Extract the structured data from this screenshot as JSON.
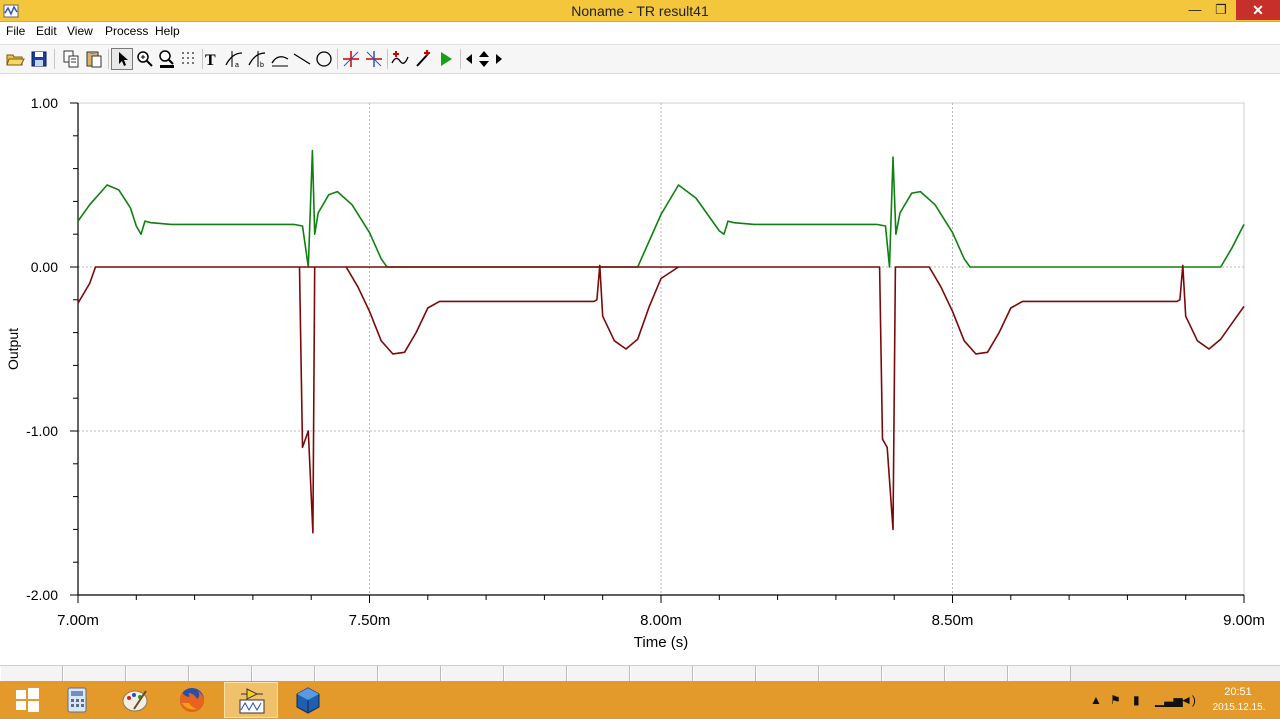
{
  "window": {
    "title": "Noname - TR result41",
    "controls": {
      "minimize": "—",
      "maximize": "❐",
      "close": "✕"
    }
  },
  "menu": [
    "File",
    "Edit",
    "View",
    "Process",
    "Help"
  ],
  "toolbar": {
    "icons": [
      "open-folder-icon",
      "save-icon",
      "copy-icon",
      "paste-icon",
      "pointer-icon",
      "zoom-in-icon",
      "zoom-100-icon",
      "grid-icon",
      "text-icon",
      "cursor-a-icon",
      "cursor-b-icon",
      "line-cursor-icon",
      "line-icon",
      "ellipse-icon",
      "marker-a-icon",
      "marker-b-icon",
      "add-curve-icon",
      "pen-icon",
      "run-icon",
      "left-arrow-icon",
      "up-down-arrow-icon",
      "right-arrow-icon"
    ]
  },
  "chart_data": {
    "type": "line",
    "xlabel": "Time (s)",
    "ylabel": "Output",
    "xlim": [
      0.007,
      0.009
    ],
    "ylim": [
      -2.0,
      1.0
    ],
    "x_ticks": [
      "7.00m",
      "7.50m",
      "8.00m",
      "8.50m",
      "9.00m"
    ],
    "x_tick_values": [
      0.007,
      0.0075,
      0.008,
      0.0085,
      0.009
    ],
    "y_ticks": [
      "1.00",
      "0.00",
      "-1.00",
      "-2.00"
    ],
    "y_tick_values": [
      1.0,
      0.0,
      -1.0,
      -2.0
    ],
    "grid": true,
    "series": [
      {
        "color": "#108010",
        "points": [
          [
            0.007,
            0.28
          ],
          [
            0.00702,
            0.38
          ],
          [
            0.00704,
            0.46
          ],
          [
            0.00705,
            0.5
          ],
          [
            0.00707,
            0.47
          ],
          [
            0.00709,
            0.36
          ],
          [
            0.0071,
            0.25
          ],
          [
            0.007108,
            0.2
          ],
          [
            0.007115,
            0.28
          ],
          [
            0.007125,
            0.27
          ],
          [
            0.00716,
            0.26
          ],
          [
            0.00737,
            0.26
          ],
          [
            0.007385,
            0.25
          ],
          [
            0.007395,
            0.0
          ],
          [
            0.007402,
            0.71
          ],
          [
            0.007406,
            0.2
          ],
          [
            0.007412,
            0.33
          ],
          [
            0.00743,
            0.44
          ],
          [
            0.007445,
            0.46
          ],
          [
            0.00747,
            0.38
          ],
          [
            0.0075,
            0.21
          ],
          [
            0.00752,
            0.05
          ],
          [
            0.00753,
            0.0
          ],
          [
            0.00796,
            0.0
          ],
          [
            0.00798,
            0.16
          ],
          [
            0.008,
            0.32
          ],
          [
            0.00803,
            0.5
          ],
          [
            0.00806,
            0.42
          ],
          [
            0.0081,
            0.22
          ],
          [
            0.008108,
            0.2
          ],
          [
            0.008115,
            0.28
          ],
          [
            0.008125,
            0.27
          ],
          [
            0.00816,
            0.26
          ],
          [
            0.00837,
            0.26
          ],
          [
            0.008385,
            0.25
          ],
          [
            0.008392,
            0.0
          ],
          [
            0.008398,
            0.67
          ],
          [
            0.008403,
            0.2
          ],
          [
            0.00841,
            0.33
          ],
          [
            0.00843,
            0.45
          ],
          [
            0.008445,
            0.46
          ],
          [
            0.00847,
            0.38
          ],
          [
            0.0085,
            0.21
          ],
          [
            0.00852,
            0.05
          ],
          [
            0.00853,
            0.0
          ],
          [
            0.00896,
            0.0
          ],
          [
            0.00898,
            0.12
          ],
          [
            0.009,
            0.26
          ]
        ]
      },
      {
        "color": "#7a0a0a",
        "points": [
          [
            0.007,
            -0.22
          ],
          [
            0.00702,
            -0.1
          ],
          [
            0.00703,
            0.0
          ],
          [
            0.00746,
            0.0
          ],
          [
            0.00748,
            -0.12
          ],
          [
            0.0075,
            -0.27
          ],
          [
            0.00752,
            -0.45
          ],
          [
            0.00754,
            -0.53
          ],
          [
            0.00756,
            -0.52
          ],
          [
            0.00758,
            -0.4
          ],
          [
            0.0076,
            -0.25
          ],
          [
            0.00762,
            -0.21
          ],
          [
            0.007885,
            -0.21
          ],
          [
            0.00789,
            -0.2
          ],
          [
            0.007895,
            0.01
          ],
          [
            0.0079,
            -0.3
          ],
          [
            0.00792,
            -0.45
          ],
          [
            0.00794,
            -0.5
          ],
          [
            0.00796,
            -0.44
          ],
          [
            0.00798,
            -0.24
          ],
          [
            0.008,
            -0.07
          ],
          [
            0.00803,
            0.0
          ],
          [
            0.00738,
            0.0
          ],
          [
            0.007385,
            -1.1
          ],
          [
            0.007395,
            -1.0
          ],
          [
            0.007403,
            -1.62
          ],
          [
            0.007406,
            0.0
          ]
        ]
      },
      {
        "color": "#7a0a0a",
        "points": [
          [
            0.00803,
            0.0
          ],
          [
            0.008375,
            0.0
          ],
          [
            0.00838,
            -1.05
          ],
          [
            0.008388,
            -1.1
          ],
          [
            0.008398,
            -1.6
          ],
          [
            0.008402,
            0.0
          ],
          [
            0.00846,
            0.0
          ],
          [
            0.00848,
            -0.12
          ],
          [
            0.0085,
            -0.27
          ],
          [
            0.00852,
            -0.45
          ],
          [
            0.00854,
            -0.53
          ],
          [
            0.00856,
            -0.52
          ],
          [
            0.00858,
            -0.4
          ],
          [
            0.0086,
            -0.25
          ],
          [
            0.00862,
            -0.21
          ],
          [
            0.008885,
            -0.21
          ],
          [
            0.00889,
            -0.2
          ],
          [
            0.008895,
            0.01
          ],
          [
            0.0089,
            -0.3
          ],
          [
            0.00892,
            -0.45
          ],
          [
            0.00894,
            -0.5
          ],
          [
            0.00896,
            -0.44
          ],
          [
            0.00898,
            -0.34
          ],
          [
            0.009,
            -0.24
          ]
        ]
      }
    ]
  },
  "tabstrip": {
    "count": 17
  },
  "taskbar": {
    "apps": [
      "windows-logo-icon",
      "calculator-icon",
      "paint-icon",
      "firefox-icon",
      "tina-icon",
      "virtualbox-icon"
    ],
    "clock_time": "20:51",
    "clock_date": "2015.12.15."
  }
}
